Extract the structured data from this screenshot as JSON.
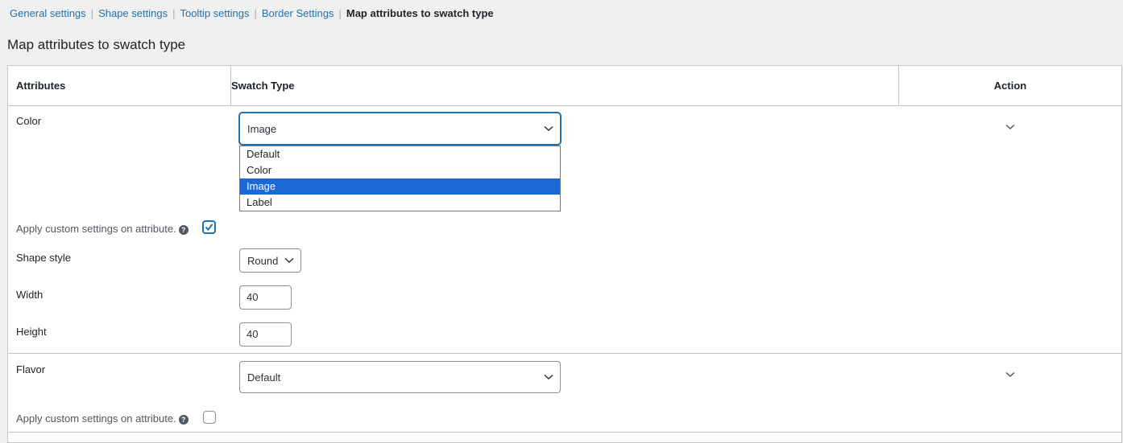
{
  "subnav": {
    "links": [
      "General settings",
      "Shape settings",
      "Tooltip settings",
      "Border Settings"
    ],
    "current": "Map attributes to swatch type",
    "separator": "|"
  },
  "page_title": "Map attributes to swatch type",
  "table": {
    "headers": {
      "attributes": "Attributes",
      "swatch_type": "Swatch Type",
      "action": "Action"
    },
    "rows": [
      {
        "attribute": "Color",
        "swatch_type": "Image",
        "dropdown_open": true,
        "options": [
          "Default",
          "Color",
          "Image",
          "Label"
        ],
        "selected_option": "Image",
        "custom_settings_label": "Apply custom settings on attribute.",
        "custom_settings_checked": true,
        "help_icon": "?",
        "shape_style_label": "Shape style",
        "shape_style_value": "Round",
        "width_label": "Width",
        "width_value": "40",
        "height_label": "Height",
        "height_value": "40",
        "action_icon": "chevron-down-icon"
      },
      {
        "attribute": "Flavor",
        "swatch_type": "Default",
        "dropdown_open": false,
        "custom_settings_label": "Apply custom settings on attribute.",
        "custom_settings_checked": false,
        "help_icon": "?",
        "action_icon": "chevron-down-icon"
      }
    ]
  },
  "colors": {
    "link": "#2271b1",
    "selected_option_bg": "#1a69d4",
    "border": "#c3c4c7",
    "page_bg": "#f0f0f1"
  }
}
